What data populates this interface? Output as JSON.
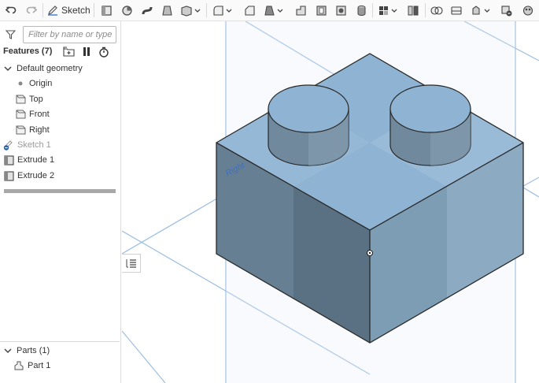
{
  "toolbar": {
    "sketch_label": "Sketch",
    "tools": [
      "undo-icon",
      "redo-icon",
      "sketch-icon",
      "extrude-icon",
      "revolve-icon",
      "sweep-icon",
      "loft-icon",
      "thicken-icon",
      "fillet-icon",
      "chamfer-icon",
      "draft-icon",
      "rib-icon",
      "shell-icon",
      "hole-icon",
      "linear-pattern-icon",
      "boolean-icon",
      "split-icon",
      "transform-icon",
      "delete-part-icon",
      "appearance-icon"
    ]
  },
  "feature_panel": {
    "filter_placeholder": "Filter by name or type",
    "features_title": "Features (7)",
    "default_geometry": "Default geometry",
    "origin": "Origin",
    "planes": [
      "Top",
      "Front",
      "Right"
    ],
    "sketch_1": "Sketch 1",
    "extrude_1": "Extrude 1",
    "extrude_2": "Extrude 2"
  },
  "parts_panel": {
    "title": "Parts (1)",
    "part_1": "Part 1"
  },
  "viewport": {
    "plane_label": "Right",
    "colors": {
      "plane_line": "#9bbde0",
      "top_face": "#8fb3d2",
      "left_face": "#667f93",
      "right_face": "#7d9db5",
      "edge": "#2a2a2a"
    }
  }
}
